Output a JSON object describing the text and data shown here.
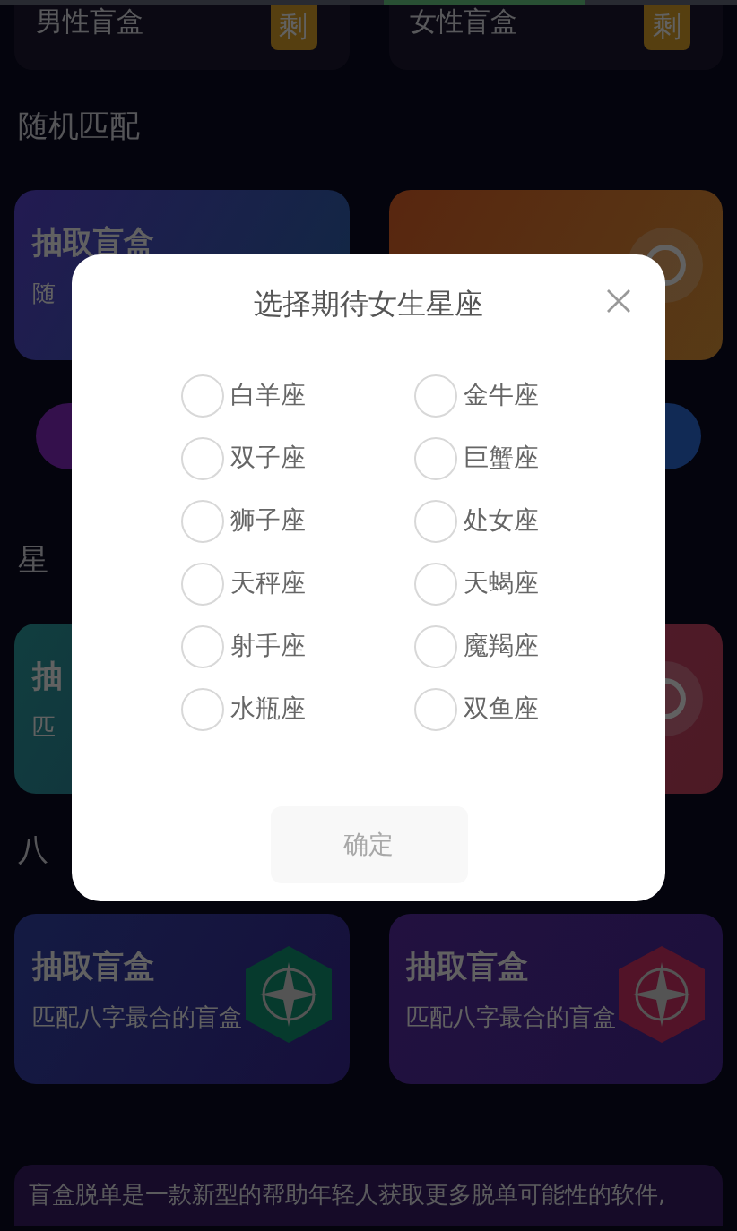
{
  "top_cards": [
    {
      "title": "男性盲盒",
      "badge": "剩"
    },
    {
      "title": "女性盲盒",
      "badge": "剩"
    }
  ],
  "sections": [
    {
      "title": "随机匹配",
      "cards": [
        {
          "title": "抽取盲盒",
          "subtitle": "随",
          "kind": "plain"
        },
        {
          "kind": "ring"
        }
      ]
    },
    {
      "title": "星",
      "cards": [
        {
          "title": "抽",
          "subtitle": "匹",
          "kind": "plain"
        },
        {
          "kind": "ring"
        }
      ]
    },
    {
      "title": "八",
      "cards": [
        {
          "title": "抽取盲盒",
          "subtitle": "匹配八字最合的盲盒",
          "kind": "compass"
        },
        {
          "title": "抽取盲盒",
          "subtitle": "匹配八字最合的盲盒",
          "kind": "compass"
        }
      ]
    }
  ],
  "description": "盲盒脱单是一款新型的帮助年轻人获取更多脱单可能性的软件,",
  "modal": {
    "title": "选择期待女生星座",
    "options": [
      {
        "label": "白羊座",
        "selected": false
      },
      {
        "label": "金牛座",
        "selected": false
      },
      {
        "label": "双子座",
        "selected": false
      },
      {
        "label": "巨蟹座",
        "selected": false
      },
      {
        "label": "狮子座",
        "selected": false
      },
      {
        "label": "处女座",
        "selected": false
      },
      {
        "label": "天秤座",
        "selected": false
      },
      {
        "label": "天蝎座",
        "selected": false
      },
      {
        "label": "射手座",
        "selected": false
      },
      {
        "label": "魔羯座",
        "selected": false
      },
      {
        "label": "水瓶座",
        "selected": false
      },
      {
        "label": "双鱼座",
        "selected": false
      }
    ],
    "confirm": {
      "label": "确定",
      "disabled": true
    }
  }
}
